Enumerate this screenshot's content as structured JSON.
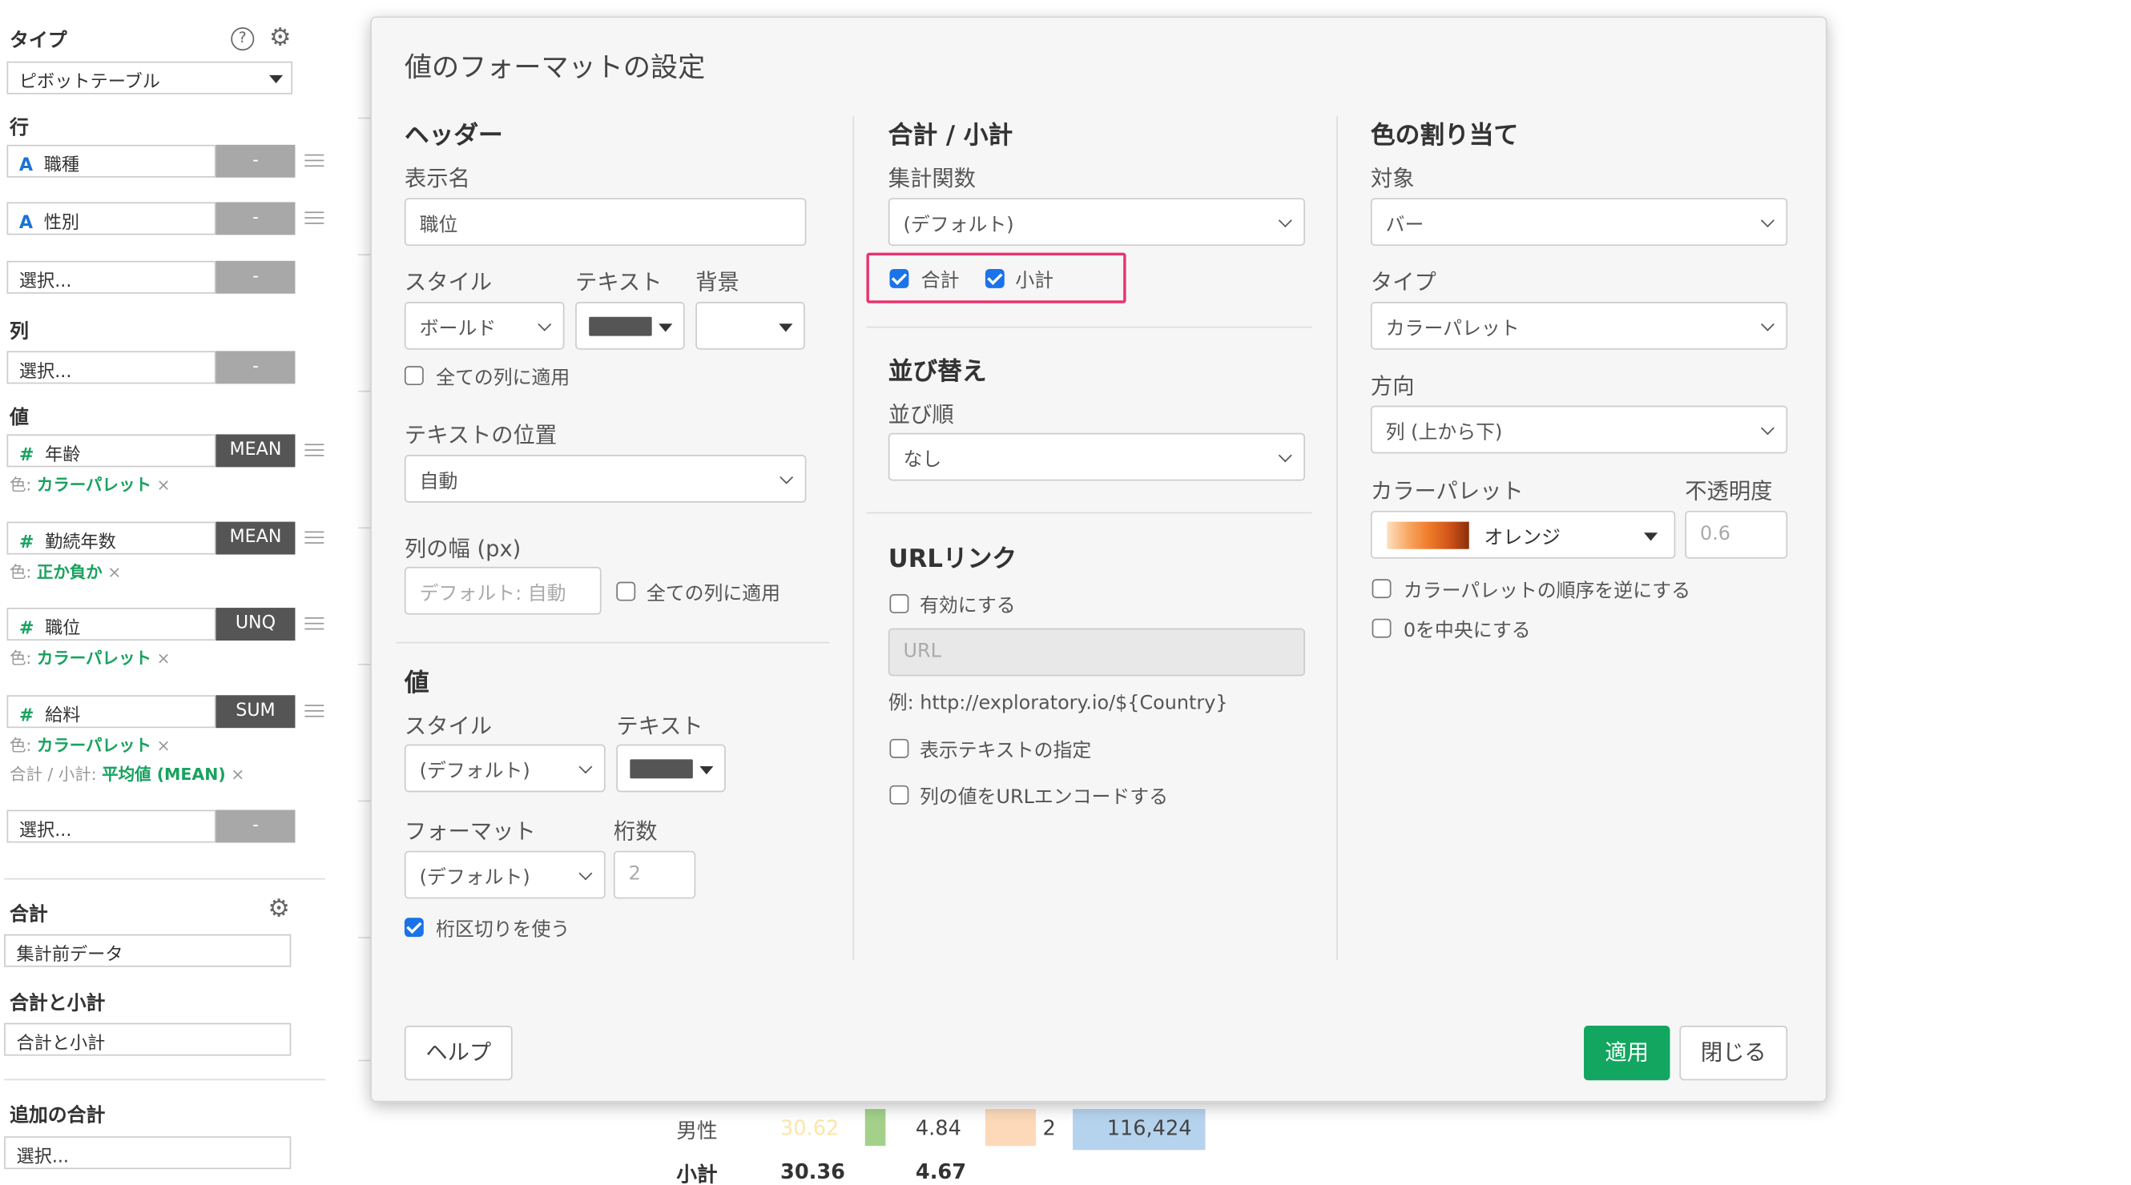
{
  "left": {
    "type_label": "タイプ",
    "type_value": "ピボットテーブル",
    "row_label": "行",
    "rows": [
      {
        "icon": "A",
        "name": "職種",
        "tag": "-"
      },
      {
        "icon": "A",
        "name": "性別",
        "tag": "-"
      },
      {
        "icon": "",
        "name": "選択...",
        "tag": "-"
      }
    ],
    "col_label": "列",
    "col_select": {
      "name": "選択...",
      "tag": "-"
    },
    "val_label": "値",
    "values": [
      {
        "icon": "#",
        "name": "年齢",
        "tag": "MEAN",
        "sub_prefix": "色:",
        "sub_value": "カラーパレット"
      },
      {
        "icon": "#",
        "name": "勤続年数",
        "tag": "MEAN",
        "sub_prefix": "色:",
        "sub_value": "正か負か"
      },
      {
        "icon": "#",
        "name": "職位",
        "tag": "UNQ",
        "sub_prefix": "色:",
        "sub_value": "カラーパレット"
      },
      {
        "icon": "#",
        "name": "給料",
        "tag": "SUM",
        "sub_prefix": "色:",
        "sub_value": "カラーパレット"
      }
    ],
    "salary_sub2_prefix": "合計 / 小計:",
    "salary_sub2_value": "平均値 (MEAN)",
    "val_select": {
      "name": "選択...",
      "tag": "-"
    },
    "total_label": "合計",
    "total_value": "集計前データ",
    "total_sub_label": "合計と小計",
    "total_sub_value": "合計と小計",
    "extra_label": "追加の合計",
    "extra_value": "選択...",
    "remove_symbol": "×"
  },
  "background": {
    "row_label": "男性",
    "row_vals": [
      "30.62",
      "4.84",
      "2",
      "116,424"
    ],
    "sub_label": "小計",
    "sub_vals": [
      "30.36",
      "4.67"
    ]
  },
  "dialog": {
    "title": "値のフォーマットの設定",
    "header": {
      "section": "ヘッダー",
      "display_name_label": "表示名",
      "display_name_value": "職位",
      "style_label": "スタイル",
      "text_label": "テキスト",
      "bg_label": "背景",
      "style_value": "ボールド",
      "apply_all_label": "全ての列に適用",
      "text_pos_label": "テキストの位置",
      "text_pos_value": "自動",
      "col_width_label": "列の幅 (px)",
      "col_width_placeholder": "デフォルト: 自動",
      "col_width_apply_all": "全ての列に適用"
    },
    "value": {
      "section": "値",
      "style_label": "スタイル",
      "text_label": "テキスト",
      "style_value": "(デフォルト)",
      "format_label": "フォーマット",
      "digits_label": "桁数",
      "format_value": "(デフォルト)",
      "digits_placeholder": "2",
      "separator_label": "桁区切りを使う"
    },
    "totals": {
      "section": "合計 / 小計",
      "agg_label": "集計関数",
      "agg_value": "(デフォルト)",
      "total_cb": "合計",
      "subtotal_cb": "小計",
      "sort_section": "並び替え",
      "sort_label": "並び順",
      "sort_value": "なし",
      "url_section": "URLリンク",
      "enable_label": "有効にする",
      "url_placeholder": "URL",
      "url_example": "例: http://exploratory.io/${Country}",
      "display_text_label": "表示テキストの指定",
      "url_encode_label": "列の値をURLエンコードする"
    },
    "color": {
      "section": "色の割り当て",
      "target_label": "対象",
      "target_value": "バー",
      "type_label": "タイプ",
      "type_value": "カラーパレット",
      "direction_label": "方向",
      "direction_value": "列 (上から下)",
      "palette_label": "カラーパレット",
      "opacity_label": "不透明度",
      "palette_value": "オレンジ",
      "opacity_placeholder": "0.6",
      "reverse_label": "カラーパレットの順序を逆にする",
      "center_zero_label": "0を中央にする"
    },
    "help_button": "ヘルプ",
    "apply_button": "適用",
    "close_button": "閉じる"
  },
  "colors": {
    "accent_green": "#13a660",
    "highlight_pink": "#e8336d",
    "checkbox_blue": "#1a73e8"
  }
}
